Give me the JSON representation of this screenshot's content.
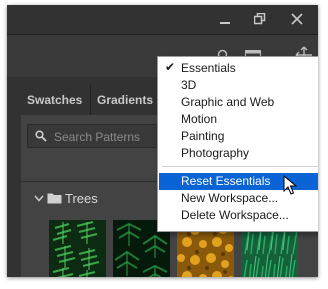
{
  "window": {
    "controls": [
      "minimize",
      "restore",
      "close"
    ]
  },
  "panel": {
    "tabs": [
      {
        "label": "Swatches"
      },
      {
        "label": "Gradients"
      }
    ],
    "search": {
      "placeholder": "Search Patterns",
      "value": ""
    },
    "group": {
      "label": "Trees",
      "expanded": true
    },
    "thumbnails": [
      {
        "name": "dark-green-ferns"
      },
      {
        "name": "green-pine-branches"
      },
      {
        "name": "autumn-foliage"
      },
      {
        "name": "green-grass"
      }
    ]
  },
  "workspace_menu": {
    "items": [
      {
        "label": "Essentials",
        "checked": true
      },
      {
        "label": "3D"
      },
      {
        "label": "Graphic and Web"
      },
      {
        "label": "Motion"
      },
      {
        "label": "Painting"
      },
      {
        "label": "Photography"
      }
    ],
    "actions": [
      {
        "label": "Reset Essentials",
        "highlighted": true
      },
      {
        "label": "New Workspace..."
      },
      {
        "label": "Delete Workspace..."
      }
    ],
    "check_glyph": "✔"
  },
  "colors": {
    "ui_dark": "#323232",
    "panel": "#434343",
    "menu_highlight": "#0a64d6"
  }
}
